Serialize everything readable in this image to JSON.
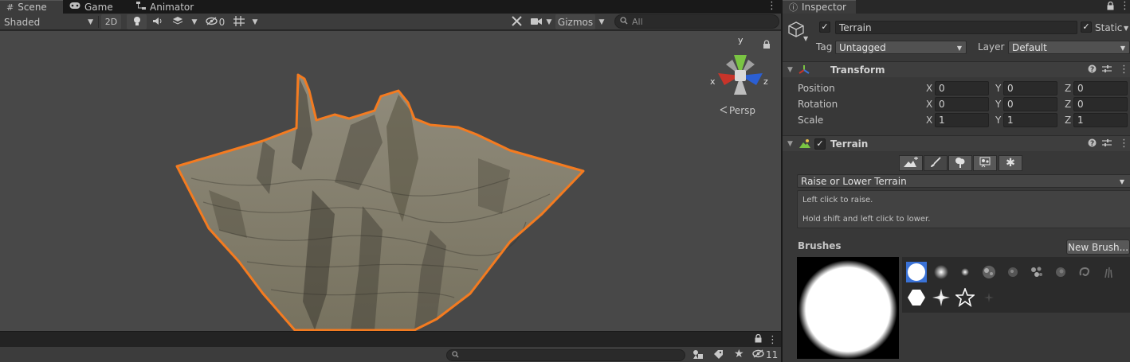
{
  "scene_tabs": [
    {
      "label": "Scene",
      "icon": "grid-icon"
    },
    {
      "label": "Game",
      "icon": "gamepad-icon"
    },
    {
      "label": "Animator",
      "icon": "animator-icon"
    }
  ],
  "toolbar": {
    "draw_mode": "Shaded",
    "mode_2d": "2D",
    "hidden_count": "0",
    "gizmos": "Gizmos",
    "search_placeholder": "All"
  },
  "viewport": {
    "projection": "Persp",
    "axes": {
      "x": "x",
      "y": "y",
      "z": "z"
    },
    "selection_outline_color": "#f47b20",
    "terrain_color": "#8a8677"
  },
  "bottom_bar": {
    "hidden_count": "11"
  },
  "inspector": {
    "tab_label": "Inspector",
    "object_name": "Terrain",
    "static_label": "Static",
    "tag_label": "Tag",
    "tag_value": "Untagged",
    "layer_label": "Layer",
    "layer_value": "Default"
  },
  "transform": {
    "title": "Transform",
    "rows": [
      {
        "label": "Position",
        "x": "0",
        "y": "0",
        "z": "0"
      },
      {
        "label": "Rotation",
        "x": "0",
        "y": "0",
        "z": "0"
      },
      {
        "label": "Scale",
        "x": "1",
        "y": "1",
        "z": "1"
      }
    ],
    "axis_labels": {
      "x": "X",
      "y": "Y",
      "z": "Z"
    }
  },
  "terrain_component": {
    "title": "Terrain",
    "tool_dropdown": "Raise or Lower Terrain",
    "help_line_1": "Left click to raise.",
    "help_line_2": "Hold shift and left click to lower.",
    "brushes_label": "Brushes",
    "new_brush_button": "New Brush..."
  },
  "colors": {
    "accent_blue": "#3a72d6",
    "axis_x_red": "#c8342a",
    "axis_y_green": "#7ac443",
    "axis_z_blue": "#2b5fd3"
  }
}
